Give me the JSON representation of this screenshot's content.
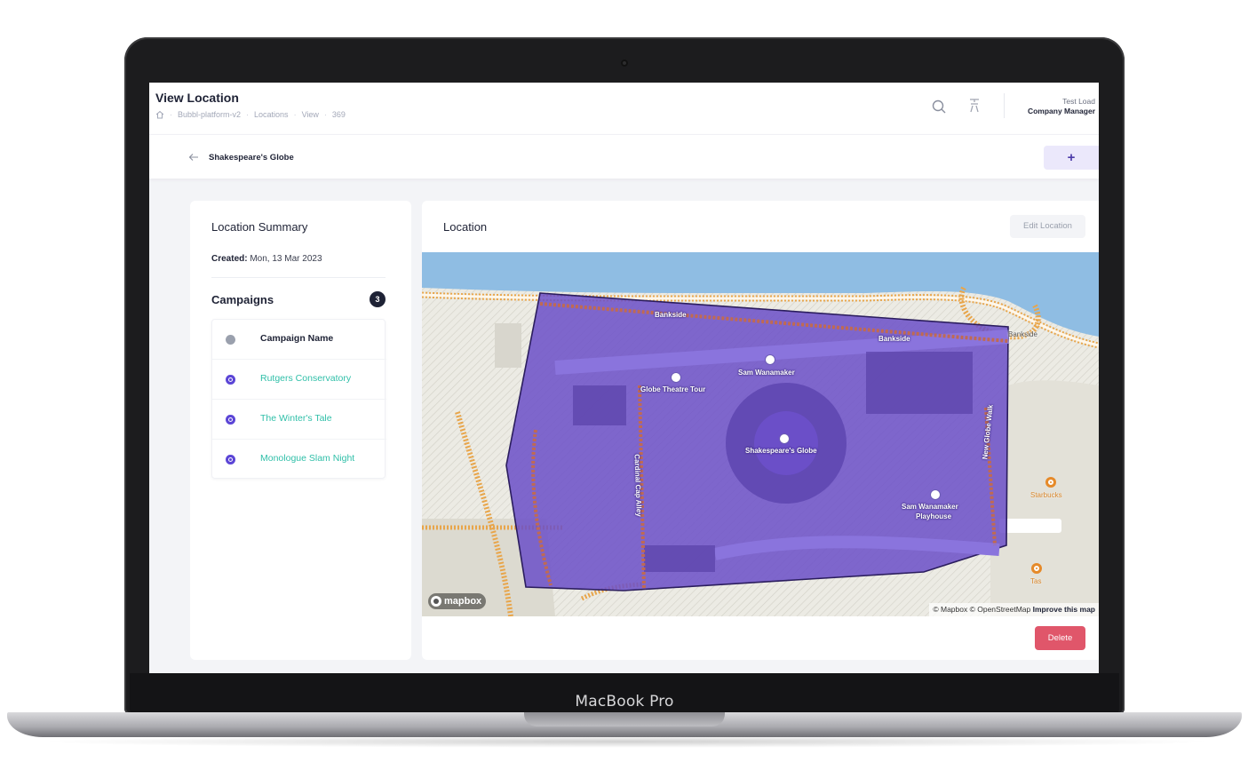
{
  "device": {
    "brand": "MacBook Pro"
  },
  "header": {
    "title": "View Location",
    "breadcrumbs": [
      "Bubbl-platform-v2",
      "Locations",
      "View",
      "369"
    ],
    "user_name": "Test Load",
    "user_role": "Company Manager"
  },
  "subbar": {
    "location_name": "Shakespeare's Globe",
    "add_label": "+"
  },
  "summary": {
    "title": "Location Summary",
    "created_label": "Created:",
    "created_value": " Mon, 13 Mar 2023",
    "campaigns_title": "Campaigns",
    "campaigns_count": "3",
    "column_header": "Campaign Name",
    "campaigns": [
      "Rutgers Conservatory",
      "The Winter's Tale",
      "Monologue Slam Night"
    ]
  },
  "location": {
    "title": "Location",
    "edit_label": "Edit Location",
    "delete_label": "Delete"
  },
  "map": {
    "logo": "mapbox",
    "attribution": "© Mapbox © OpenStreetMap",
    "improve": "Improve this map",
    "labels": {
      "bankside_1": "Bankside",
      "bankside_2": "Bankside",
      "bankside_3": "Bankside",
      "sam_wanamaker": "Sam Wanamaker",
      "globe_tour": "Globe Theatre Tour",
      "shakespeares_globe": "Shakespeare's Globe",
      "playhouse_1": "Sam Wanamaker",
      "playhouse_2": "Playhouse",
      "new_globe_walk": "New Globe Walk",
      "cardinal_cap": "Cardinal Cap Alley",
      "starbucks": "Starbucks",
      "tas": "Tas"
    },
    "colors": {
      "water": "#8fbde3",
      "polygon": "#6b4fc8",
      "road_casing": "#e8a54a",
      "land": "#e8e6de"
    }
  },
  "colors": {
    "accent": "#5b45d6",
    "link": "#2fbfa8",
    "danger": "#e0566a"
  }
}
